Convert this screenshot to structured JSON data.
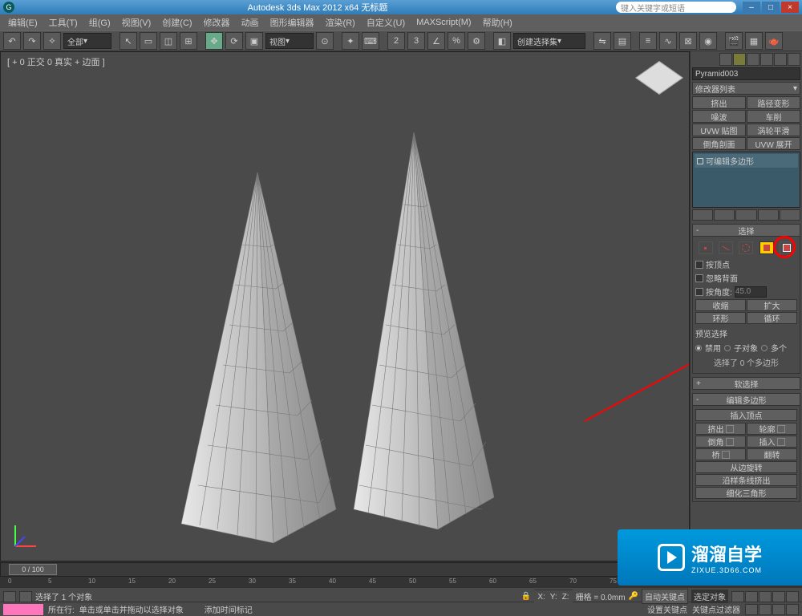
{
  "title": "Autodesk 3ds Max 2012 x64   无标题",
  "search_placeholder": "键入关键字或短语",
  "menus": [
    "编辑(E)",
    "工具(T)",
    "组(G)",
    "视图(V)",
    "创建(C)",
    "修改器",
    "动画",
    "图形编辑器",
    "渲染(R)",
    "自定义(U)",
    "MAXScript(M)",
    "帮助(H)"
  ],
  "toolbar": {
    "all": "全部",
    "view": "视图",
    "createset": "创建选择集"
  },
  "viewport_label": "[ + 0 正交 0 真实 + 边面 ]",
  "object_name": "Pyramid003",
  "modifier_dropdown": "修改器列表",
  "mod_buttons": [
    "挤出",
    "路径变形",
    "噪波",
    "车削",
    "UVW 贴图",
    "涡轮平滑",
    "倒角剖面",
    "UVW 展开"
  ],
  "stack_item": "可编辑多边形",
  "rollouts": {
    "selection": "选择",
    "by_vertex": "按顶点",
    "ignore_backfacing": "忽略背面",
    "by_angle": "按角度:",
    "angle_val": "45.0",
    "shrink": "收缩",
    "grow": "扩大",
    "ring": "环形",
    "loop": "循环",
    "preview_sel": "预览选择",
    "disable": "禁用",
    "subobj": "子对象",
    "multi": "多个",
    "selected_info": "选择了 0 个多边形",
    "soft_sel": "软选择",
    "edit_poly": "编辑多边形",
    "insert_vertex": "插入顶点",
    "extrude": "挤出",
    "outline": "轮廓",
    "bevel": "倒角",
    "insert": "插入",
    "bridge": "桥",
    "flip": "翻转",
    "hinge": "从边旋转",
    "extrude_spline": "沿样条线挤出",
    "edit_tri": "细化三角形"
  },
  "timeline": {
    "range": "0 / 100"
  },
  "status": {
    "line1": "选择了 1 个对象",
    "line2": "单击或单击并拖动以选择对象",
    "loc": "所在行:",
    "addtime": "添加时间标记",
    "grid": "栅格 = 0.0mm",
    "autokey": "自动关键点",
    "selset": "选定对象",
    "setkey": "设置关键点",
    "keyfilter": "关键点过滤器"
  },
  "watermark": {
    "main": "溜溜自学",
    "sub": "ZIXUE.3D66.COM"
  }
}
